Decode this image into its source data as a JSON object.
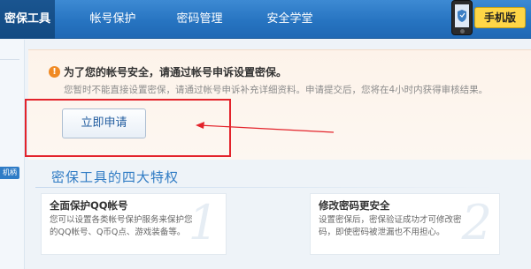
{
  "nav": {
    "tabs": [
      {
        "label": "密保工具",
        "active": true
      },
      {
        "label": "帐号保护",
        "active": false
      },
      {
        "label": "密码管理",
        "active": false
      },
      {
        "label": "安全学堂",
        "active": false
      }
    ],
    "mobile_label": "手机版"
  },
  "side": {
    "tag": "机柄"
  },
  "notice": {
    "icon": "warning-icon",
    "icon_glyph": "!",
    "title": "为了您的帐号安全，请通过帐号申诉设置密保。",
    "description": "您暂时不能直接设置密保，请通过帐号申诉补充详细资料。申请提交后，您将在4小时内获得审核结果。",
    "apply_button": "立即申请"
  },
  "features": {
    "title": "密保工具的四大特权",
    "cards": [
      {
        "number": "1",
        "heading": "全面保护QQ帐号",
        "text": "您可以设置各类帐号保护服务来保护您的QQ帐号、Q币Q点、游戏装备等。"
      },
      {
        "number": "2",
        "heading": "修改密码更安全",
        "text": "设置密保后，密保验证成功才可修改密码，即使密码被泄漏也不用担心。"
      }
    ]
  },
  "colors": {
    "nav_bg": "#2774c1",
    "accent": "#2f7bc4",
    "warning": "#f08a24",
    "highlight_box": "#e3232b"
  }
}
